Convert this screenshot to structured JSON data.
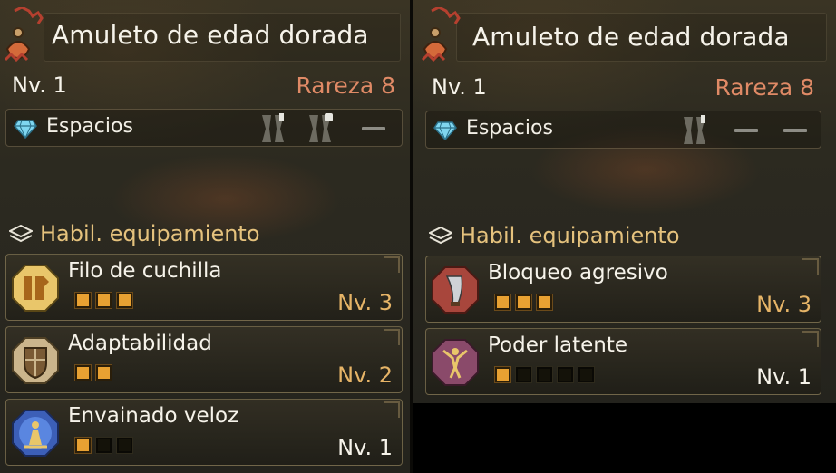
{
  "panels": [
    {
      "title": "Amuleto de edad dorada",
      "level": "Nv. 1",
      "rarity": "Rareza 8",
      "slots_label": "Espacios",
      "slots": [
        {
          "type": "filled",
          "size": 1
        },
        {
          "type": "filled",
          "size": 2
        },
        {
          "type": "empty"
        }
      ],
      "skills_label": "Habil. equipamiento",
      "skills": [
        {
          "name": "Filo de cuchilla",
          "level": "Nv. 3",
          "filled": 3,
          "max": 3,
          "icon": "blade-sharpness-icon",
          "level_color": "gold"
        },
        {
          "name": "Adaptabilidad",
          "level": "Nv. 2",
          "filled": 2,
          "max": 2,
          "icon": "shield-crest-icon",
          "level_color": "gold"
        },
        {
          "name": "Envainado veloz",
          "level": "Nv. 1",
          "filled": 1,
          "max": 3,
          "icon": "sheathe-figure-icon",
          "level_color": "white"
        }
      ]
    },
    {
      "title": "Amuleto de edad dorada",
      "level": "Nv. 1",
      "rarity": "Rareza 8",
      "slots_label": "Espacios",
      "slots": [
        {
          "type": "filled",
          "size": 1
        },
        {
          "type": "empty"
        },
        {
          "type": "empty"
        }
      ],
      "skills_label": "Habil. equipamiento",
      "skills": [
        {
          "name": "Bloqueo agresivo",
          "level": "Nv. 3",
          "filled": 3,
          "max": 3,
          "icon": "blade-guard-icon",
          "level_color": "gold"
        },
        {
          "name": "Poder latente",
          "level": "Nv. 1",
          "filled": 1,
          "max": 5,
          "icon": "power-figure-icon",
          "level_color": "white"
        }
      ]
    }
  ],
  "colors": {
    "rarity": "#e08a66",
    "section_header": "#e5c27d",
    "pip_on": "#e8a132",
    "level_gold": "#e6b467"
  }
}
